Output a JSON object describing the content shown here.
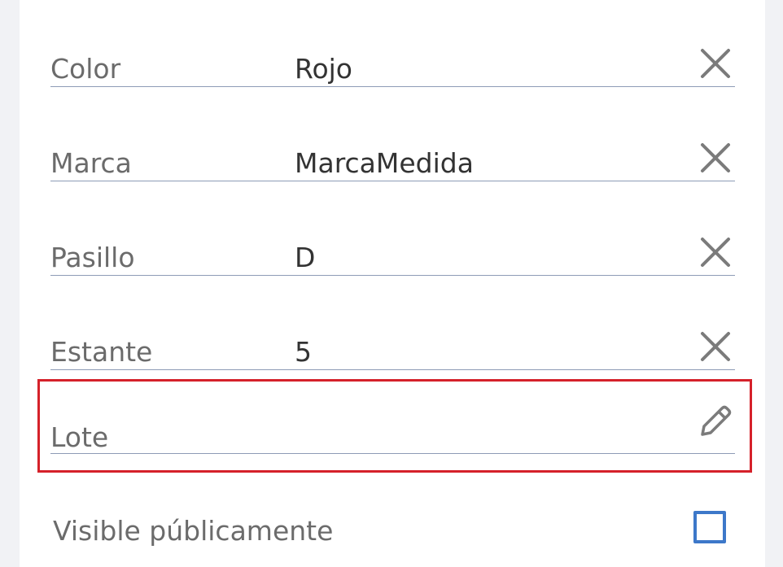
{
  "fields": [
    {
      "label": "Color",
      "value": "Rojo",
      "action_icon": "close-icon"
    },
    {
      "label": "Marca",
      "value": "MarcaMedida",
      "action_icon": "close-icon"
    },
    {
      "label": "Pasillo",
      "value": "D",
      "action_icon": "close-icon"
    },
    {
      "label": "Estante",
      "value": "5",
      "action_icon": "close-icon"
    }
  ],
  "lote": {
    "label": "Lote",
    "value": "",
    "action_icon": "pencil-icon",
    "highlight_color": "#d5212a"
  },
  "visibility": {
    "label": "Visible públicamente",
    "checked": false,
    "checkbox_color": "#3d78c9"
  },
  "colors": {
    "background": "#f1f2f5",
    "card": "#ffffff",
    "label_text": "#6b6b6b",
    "value_text": "#333333",
    "underline": "#8d9bb6",
    "icon": "#7b7b7b"
  }
}
